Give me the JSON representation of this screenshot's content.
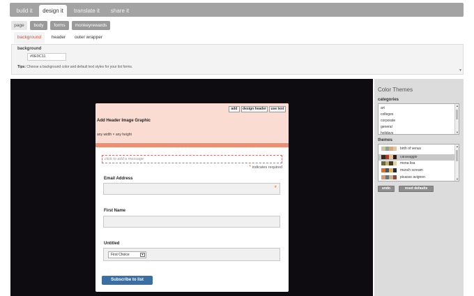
{
  "top_tabs": [
    {
      "label": "build it"
    },
    {
      "label": "design it"
    },
    {
      "label": "translate it"
    },
    {
      "label": "share it"
    }
  ],
  "sub_tabs": [
    {
      "label": "page"
    },
    {
      "label": "body"
    },
    {
      "label": "forms"
    },
    {
      "label": "monkeyrewards"
    }
  ],
  "page_tabs": [
    {
      "label": "background"
    },
    {
      "label": "header"
    },
    {
      "label": "outer wrapper"
    }
  ],
  "settings": {
    "background_label": "background",
    "background_value": "#0E0C11",
    "tips_bold": "Tips:",
    "tips_text": "Choose a background color and default text styles for your list forms."
  },
  "form": {
    "header_buttons": [
      "add",
      "design header",
      "use text"
    ],
    "header_title": "Add Header Image Graphic",
    "header_size": "any width × any height",
    "message_placeholder": "click to add a message",
    "required_note": "indicates required",
    "required_mark": "*",
    "fields": [
      {
        "label": "Email Address",
        "required": true
      },
      {
        "label": "First Name",
        "required": false
      },
      {
        "label": "Untitled",
        "required": false
      }
    ],
    "select_value": "First Choice",
    "submit_label": "Subscribe to list"
  },
  "themes": {
    "title": "Color Themes",
    "categories_label": "categories",
    "categories": [
      "art",
      "colleges",
      "corporate",
      "general",
      "holidays"
    ],
    "themes_label": "themes",
    "items": [
      {
        "name": "birth of venus",
        "selected": false,
        "colors": [
          "#c9c59c",
          "#7fa8a0",
          "#d9a87f",
          "#e0c6a3"
        ]
      },
      {
        "name": "caravaggio",
        "selected": true,
        "colors": [
          "#3a2a1e",
          "#b63a25",
          "#e6c394",
          "#2b1a13"
        ]
      },
      {
        "name": "mona lisa",
        "selected": false,
        "colors": [
          "#6b6a3c",
          "#c8ad6d",
          "#3e3a22",
          "#e3d3a3"
        ]
      },
      {
        "name": "munch scream",
        "selected": false,
        "colors": [
          "#d9702b",
          "#3a5b7a",
          "#e6b15a",
          "#1e2a38"
        ]
      },
      {
        "name": "picasso avignon",
        "selected": false,
        "colors": [
          "#d49a7a",
          "#5b7a8c",
          "#c9b28f",
          "#8c4a3a"
        ]
      }
    ],
    "undo_label": "undo",
    "reset_label": "reset defaults"
  },
  "colors": {
    "preview_background": "#0e0c11",
    "header_background": "#fbdcd3",
    "accent_stripe": "#ee8e72",
    "submit_button": "#3a6fa3",
    "active_tab_text": "#c8553d"
  }
}
